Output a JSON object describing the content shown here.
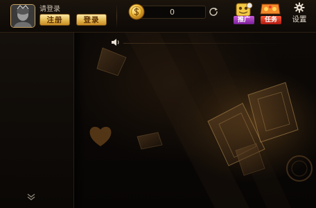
{
  "header": {
    "login_prompt": "请登录",
    "register_label": "注册",
    "login_label": "登录",
    "coin_balance": "0",
    "promo_label": "推广",
    "task_label": "任务",
    "settings_label": "设置"
  },
  "icons": {
    "avatar": "avatar-icon",
    "coin": "coin-icon",
    "refresh": "refresh-icon",
    "promo": "promo-icon",
    "task": "task-icon",
    "settings": "gear-icon",
    "speaker": "speaker-icon",
    "scroll": "chevron-double-down-icon"
  },
  "colors": {
    "gold_button": "#e3b74f",
    "button_text": "#5a2e04",
    "background": "#070504",
    "promo_ribbon": "#7a1e9a",
    "task_ribbon": "#b01a10"
  }
}
